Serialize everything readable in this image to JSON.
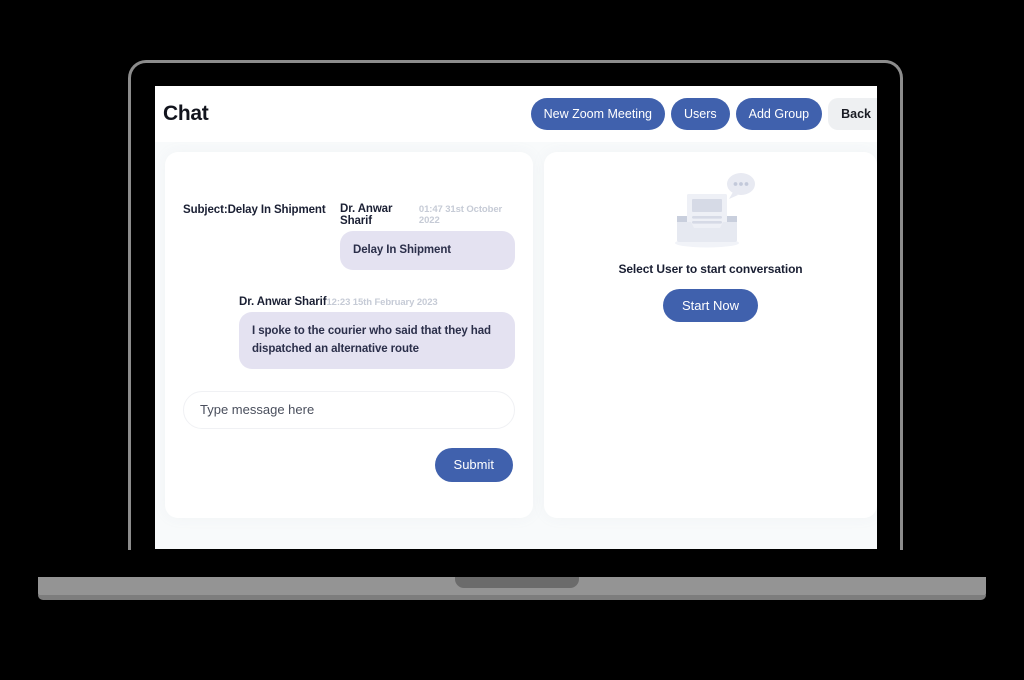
{
  "header": {
    "title": "Chat",
    "buttons": [
      {
        "label": "New Zoom Meeting",
        "style": "primary"
      },
      {
        "label": "Users",
        "style": "primary"
      },
      {
        "label": "Add Group",
        "style": "primary"
      },
      {
        "label": "Back",
        "style": "light"
      }
    ]
  },
  "chat": {
    "subject": "Subject:Delay In Shipment",
    "messages": [
      {
        "author": "Dr. Anwar Sharif",
        "time": "01:47 31st October 2022",
        "text": "Delay In Shipment"
      },
      {
        "author": "Dr. Anwar Sharif",
        "time": "12:23 15th February 2023",
        "text": "I spoke to the courier who said that they had dispatched an alternative route"
      }
    ],
    "composer": {
      "placeholder": "Type message here",
      "value": "",
      "submit_label": "Submit"
    }
  },
  "empty_state": {
    "illustration": "inbox-with-chat-bubble-icon",
    "message": "Select User to start conversation",
    "action_label": "Start Now"
  },
  "colors": {
    "accent_blue": "#4061ad",
    "bubble_lavender": "#e4e2f1",
    "bubble_text": "#2b2f4a",
    "timestamp_gray": "#c6cbd6",
    "page_background": "#f8fafb",
    "light_button": "#eef0f2"
  }
}
